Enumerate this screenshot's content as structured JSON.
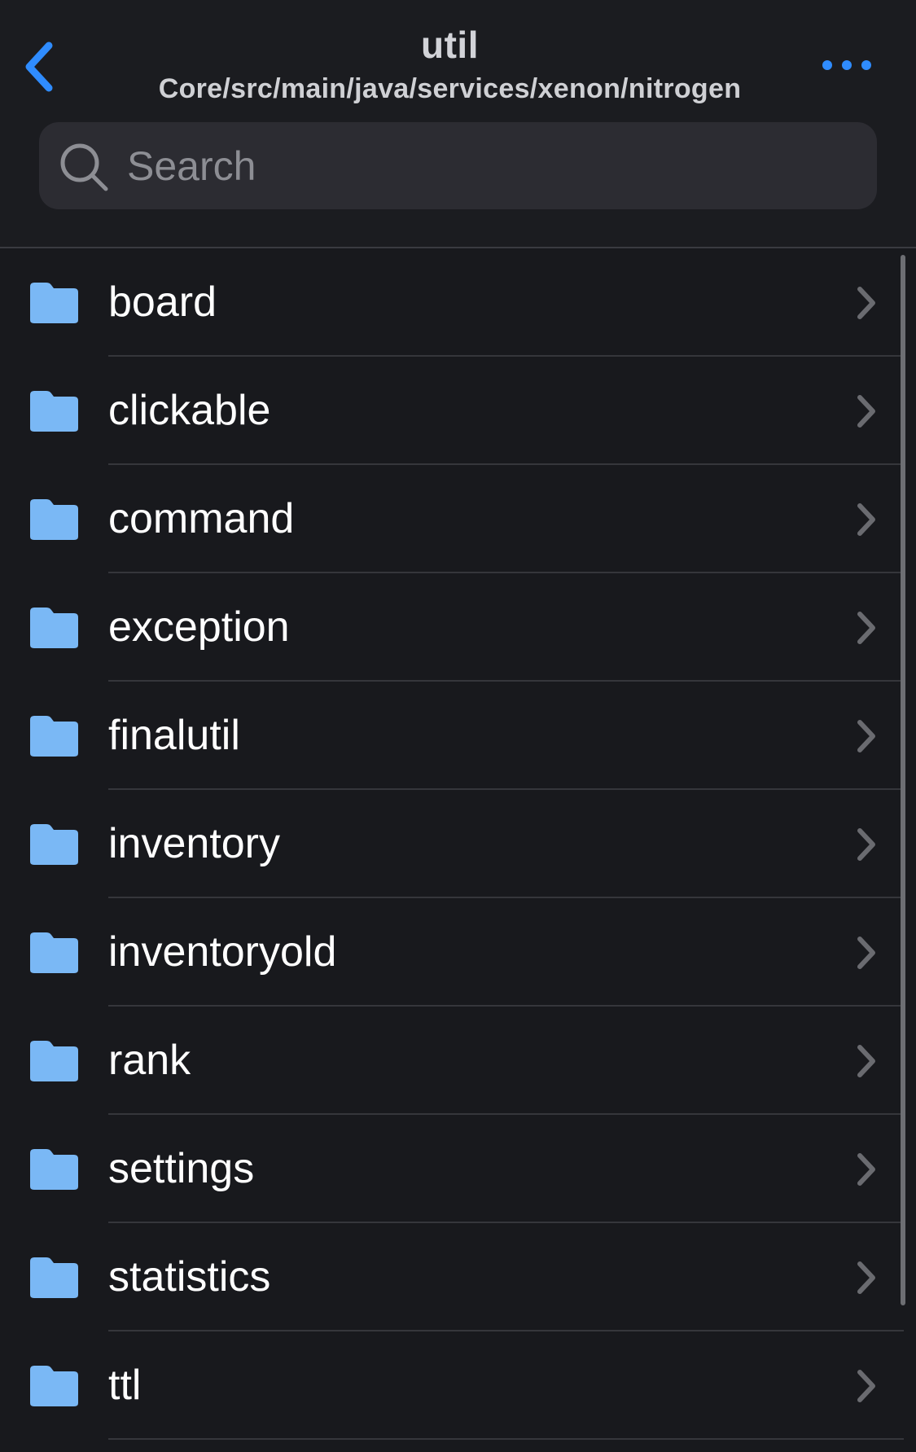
{
  "header": {
    "title": "util",
    "path": "Core/src/main/java/services/xenon/nitrogen",
    "back_icon": "chevron-left-icon",
    "more_icon": "ellipsis-icon"
  },
  "search": {
    "placeholder": "Search",
    "value": ""
  },
  "colors": {
    "accent": "#2f8cff",
    "folder": "#7ab8f5",
    "background": "#18191d",
    "chevron": "#6a6b70"
  },
  "folders": [
    {
      "name": "board"
    },
    {
      "name": "clickable"
    },
    {
      "name": "command"
    },
    {
      "name": "exception"
    },
    {
      "name": "finalutil"
    },
    {
      "name": "inventory"
    },
    {
      "name": "inventoryold"
    },
    {
      "name": "rank"
    },
    {
      "name": "settings"
    },
    {
      "name": "statistics"
    },
    {
      "name": "ttl"
    }
  ]
}
